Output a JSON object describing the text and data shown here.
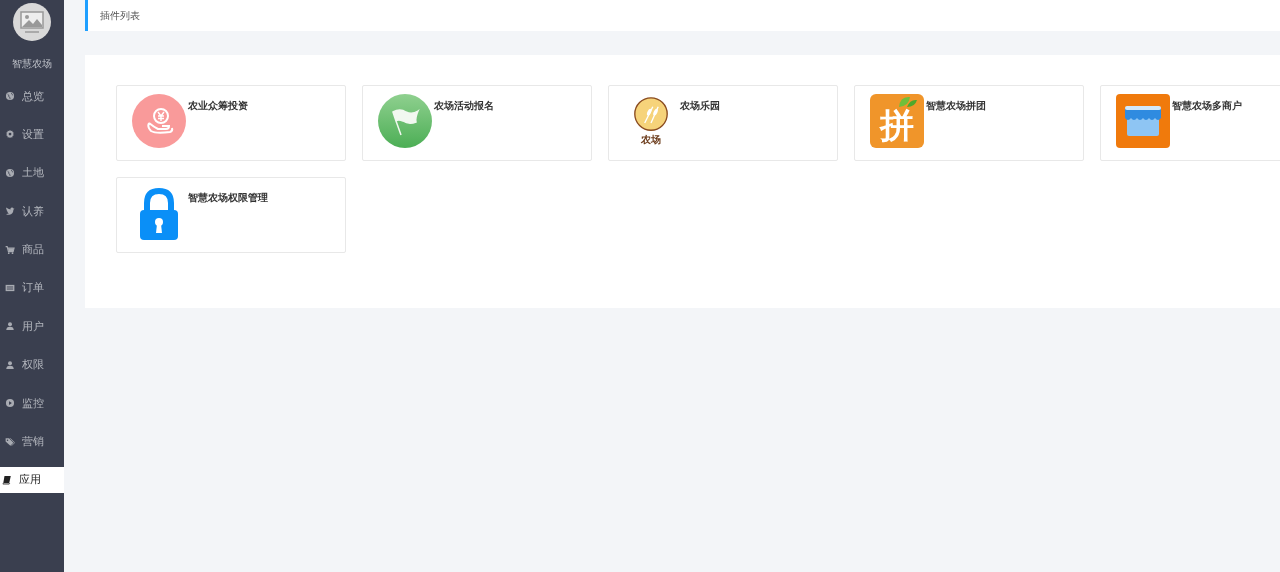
{
  "sidebar": {
    "brand": "智慧农场",
    "items": [
      {
        "label": "总览",
        "kind": "globe",
        "selected": false
      },
      {
        "label": "设置",
        "kind": "gear",
        "selected": false
      },
      {
        "label": "土地",
        "kind": "globe",
        "selected": false
      },
      {
        "label": "认养",
        "kind": "bird",
        "selected": false
      },
      {
        "label": "商品",
        "kind": "cart",
        "selected": false
      },
      {
        "label": "订单",
        "kind": "list",
        "selected": false
      },
      {
        "label": "用户",
        "kind": "user",
        "selected": false
      },
      {
        "label": "权限",
        "kind": "user",
        "selected": false
      },
      {
        "label": "监控",
        "kind": "play",
        "selected": false
      },
      {
        "label": "营销",
        "kind": "tag",
        "selected": false
      },
      {
        "label": "应用",
        "kind": "book",
        "selected": true
      }
    ]
  },
  "breadcrumb": "插件列表",
  "plugins": [
    {
      "name": "农业众筹投资",
      "kind": "coin"
    },
    {
      "name": "农场活动报名",
      "kind": "flag"
    },
    {
      "name": "农场乐园",
      "kind": "wheat",
      "icon_text": "农场"
    },
    {
      "name": "智慧农场拼团",
      "kind": "pin",
      "icon_text": "拼"
    },
    {
      "name": "智慧农场多商户",
      "kind": "shop"
    },
    {
      "name": "智慧农场权限管理",
      "kind": "lock"
    }
  ]
}
